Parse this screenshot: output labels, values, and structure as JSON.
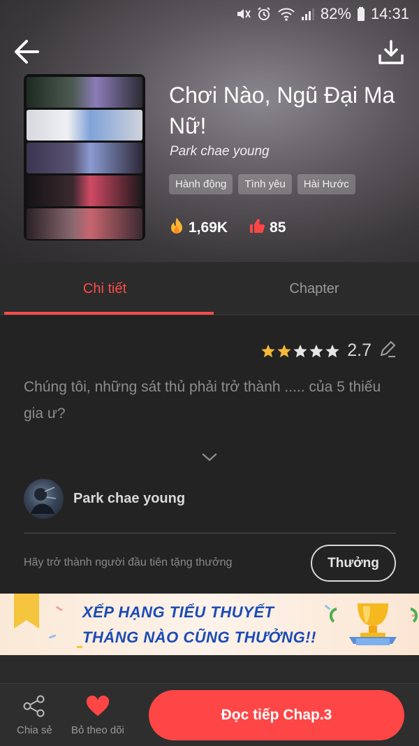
{
  "status_bar": {
    "battery": "82%",
    "time": "14:31"
  },
  "story": {
    "title": "Chơi Nào, Ngũ Đại Ma Nữ!",
    "author": "Park chae young",
    "tags": [
      "Hành động",
      "Tình yêu",
      "Hài Hước"
    ],
    "views": "1,69K",
    "likes": "85"
  },
  "tabs": [
    {
      "label": "Chi tiết",
      "active": true
    },
    {
      "label": "Chapter",
      "active": false
    }
  ],
  "detail": {
    "rating": {
      "stars": 2.7,
      "value": "2.7"
    },
    "description": "Chúng tôi, những sát thủ phải trở thành ..... của 5 thiếu gia ư?",
    "author_name": "Park chae young",
    "reward_text": "Hãy trở thành người đầu tiên tặng thưởng",
    "reward_button": "Thưởng"
  },
  "banner": {
    "line1": "XẾP HẠNG TIỂU THUYẾT",
    "line2": "THÁNG NÀO CŨNG THƯỞNG!!"
  },
  "bottom_bar": {
    "share_label": "Chia sẻ",
    "unfollow_label": "Bỏ theo dõi",
    "read_button": "Đọc tiếp Chap.3"
  },
  "colors": {
    "accent": "#ff4646",
    "star": "#f5b83a",
    "banner_text": "#1b4bb5"
  }
}
